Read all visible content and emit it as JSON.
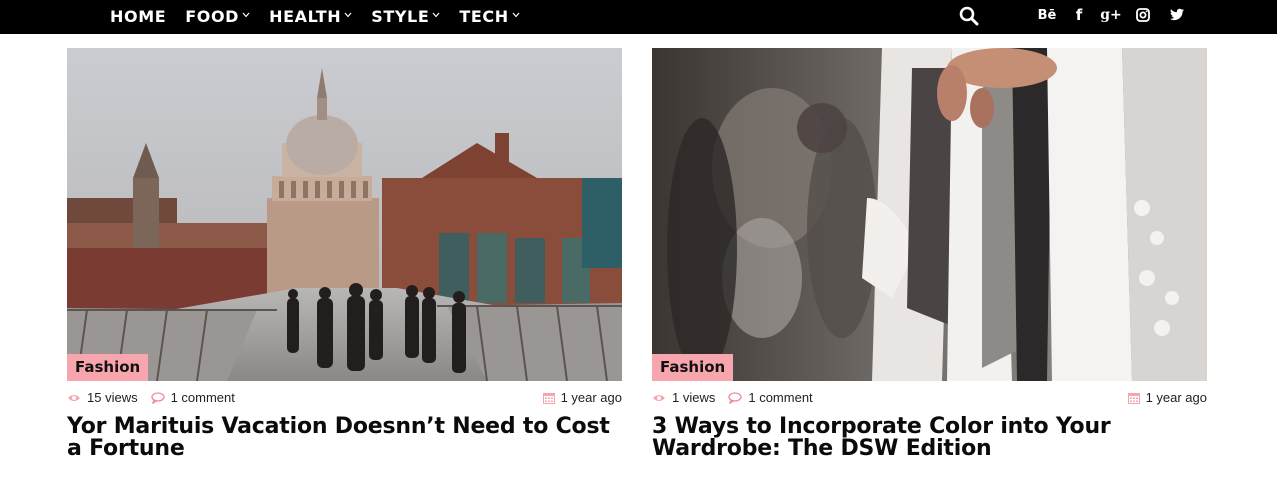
{
  "nav": {
    "items": [
      {
        "label": "HOME",
        "has_dropdown": false
      },
      {
        "label": "FOOD",
        "has_dropdown": true
      },
      {
        "label": "HEALTH",
        "has_dropdown": true
      },
      {
        "label": "STYLE",
        "has_dropdown": true
      },
      {
        "label": "TECH",
        "has_dropdown": true
      }
    ],
    "icons": [
      "search-icon",
      "behance-icon",
      "facebook-icon",
      "google-plus-icon",
      "instagram-icon",
      "twitter-icon"
    ],
    "social_text": {
      "behance": "Bē",
      "facebook": "f",
      "google_plus": "g+"
    }
  },
  "colors": {
    "nav_bg": "#000000",
    "accent": "#f7a6ae",
    "meta_icon": "#f08a96"
  },
  "posts": [
    {
      "category": "Fashion",
      "views": "15 views",
      "comments": "1 comment",
      "date": "1 year ago",
      "title": "Yor Marituis Vacation Doesnn’t Need to Cost a Fortune",
      "image": "cathedral-bridge-photo"
    },
    {
      "category": "Fashion",
      "views": "1 views",
      "comments": "1 comment",
      "date": "1 year ago",
      "title": "3 Ways to Incorporate Color into Your Wardrobe: The DSW Edition",
      "image": "clothing-rack-photo"
    }
  ]
}
